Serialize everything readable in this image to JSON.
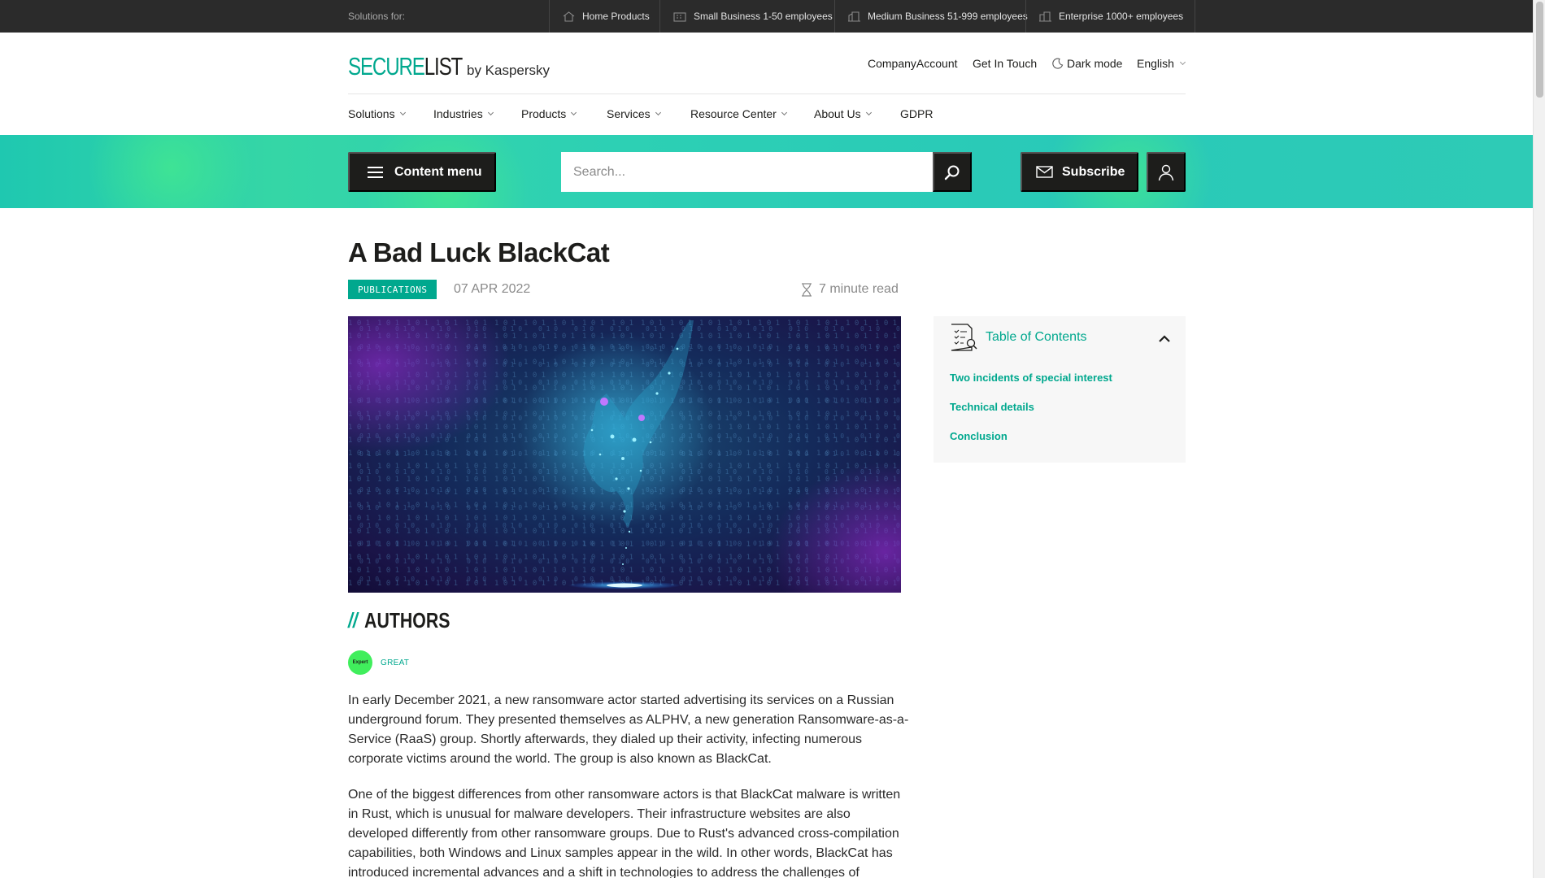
{
  "topbar": {
    "solutions_for": "Solutions for:",
    "segments": [
      {
        "label": "Home Products",
        "icon": "home-icon"
      },
      {
        "label": "Small Business 1-50 employees",
        "icon": "small-business-icon"
      },
      {
        "label": "Medium Business 51-999 employees",
        "icon": "medium-business-icon"
      },
      {
        "label": "Enterprise 1000+ employees",
        "icon": "enterprise-icon"
      }
    ]
  },
  "header": {
    "logo_secure": "SECURE",
    "logo_list": "LIST",
    "logo_by": "by Kaspersky",
    "links": {
      "company_account": "CompanyAccount",
      "get_in_touch": "Get In Touch",
      "dark_mode": "Dark mode",
      "language": "English"
    },
    "nav": [
      "Solutions",
      "Industries",
      "Products",
      "Services",
      "Resource Center",
      "About Us",
      "GDPR"
    ]
  },
  "band": {
    "content_menu": "Content menu",
    "search_placeholder": "Search...",
    "subscribe": "Subscribe"
  },
  "article": {
    "title": "A Bad Luck BlackCat",
    "tag": "PUBLICATIONS",
    "date": "07 APR 2022",
    "read_time": "7 minute read",
    "authors_heading": "AUTHORS",
    "authors_slashes": "//",
    "author": {
      "badge": "Expert",
      "name": "GREAT"
    },
    "paragraphs": [
      "In early December 2021, a new ransomware actor started advertising its services on a Russian underground forum. They presented themselves as ALPHV, a new generation Ransomware-as-a-Service (RaaS) group. Shortly afterwards, they dialed up their activity, infecting numerous corporate victims around the world. The group is also known as BlackCat.",
      "One of the biggest differences from other ransomware actors is that BlackCat malware is written in Rust, which is unusual for malware developers. Their infrastructure websites are also developed differently from other ransomware groups. Due to Rust's advanced cross-compilation capabilities, both Windows and Linux samples appear in the wild. In other words, BlackCat has introduced incremental advances and a shift in technologies to address the challenges of"
    ]
  },
  "toc": {
    "title": "Table of Contents",
    "items": [
      "Two incidents of special interest",
      "Technical details",
      "Conclusion"
    ]
  },
  "colors": {
    "accent": "#00a88e",
    "dark": "#1d1d1b",
    "band": "#2dd0b4"
  }
}
